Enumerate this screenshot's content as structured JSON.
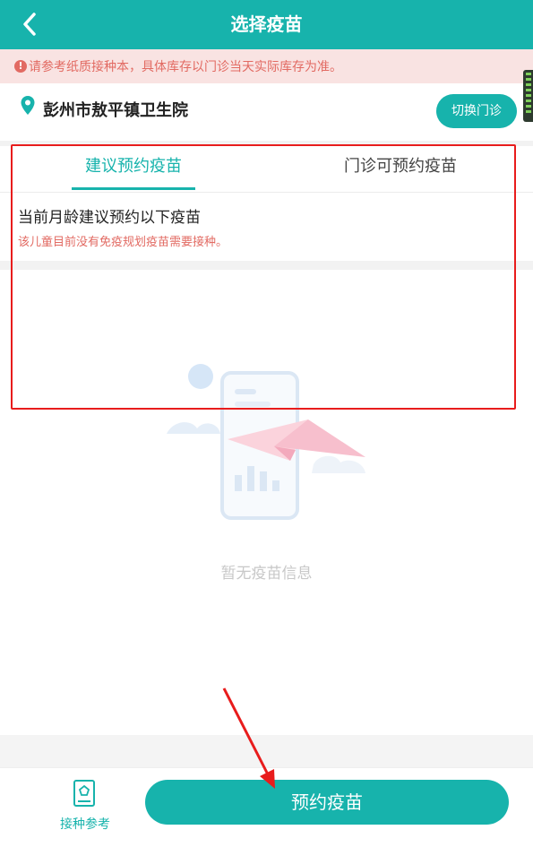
{
  "header": {
    "title": "选择疫苗",
    "back_icon": "chevron-left-icon"
  },
  "notice": {
    "text": "请参考纸质接种本，具体库存以门诊当天实际库存为准。",
    "icon": "exclamation-circle-icon"
  },
  "clinic": {
    "name": "彭州市敖平镇卫生院",
    "switch_label": "切换门诊",
    "icon": "location-pin-icon"
  },
  "tabs": [
    {
      "label": "建议预约疫苗",
      "active": true
    },
    {
      "label": "门诊可预约疫苗",
      "active": false
    }
  ],
  "suggestion": {
    "heading": "当前月龄建议预约以下疫苗",
    "note": "该儿童目前没有免疫规划疫苗需要接种。"
  },
  "empty_state": {
    "text": "暂无疫苗信息"
  },
  "bottom": {
    "reference_label": "接种参考",
    "reference_icon": "booklet-icon",
    "book_label": "预约疫苗"
  },
  "colors": {
    "accent": "#17b3ac",
    "warning": "#e26a62",
    "annotation": "#e81c1c"
  }
}
